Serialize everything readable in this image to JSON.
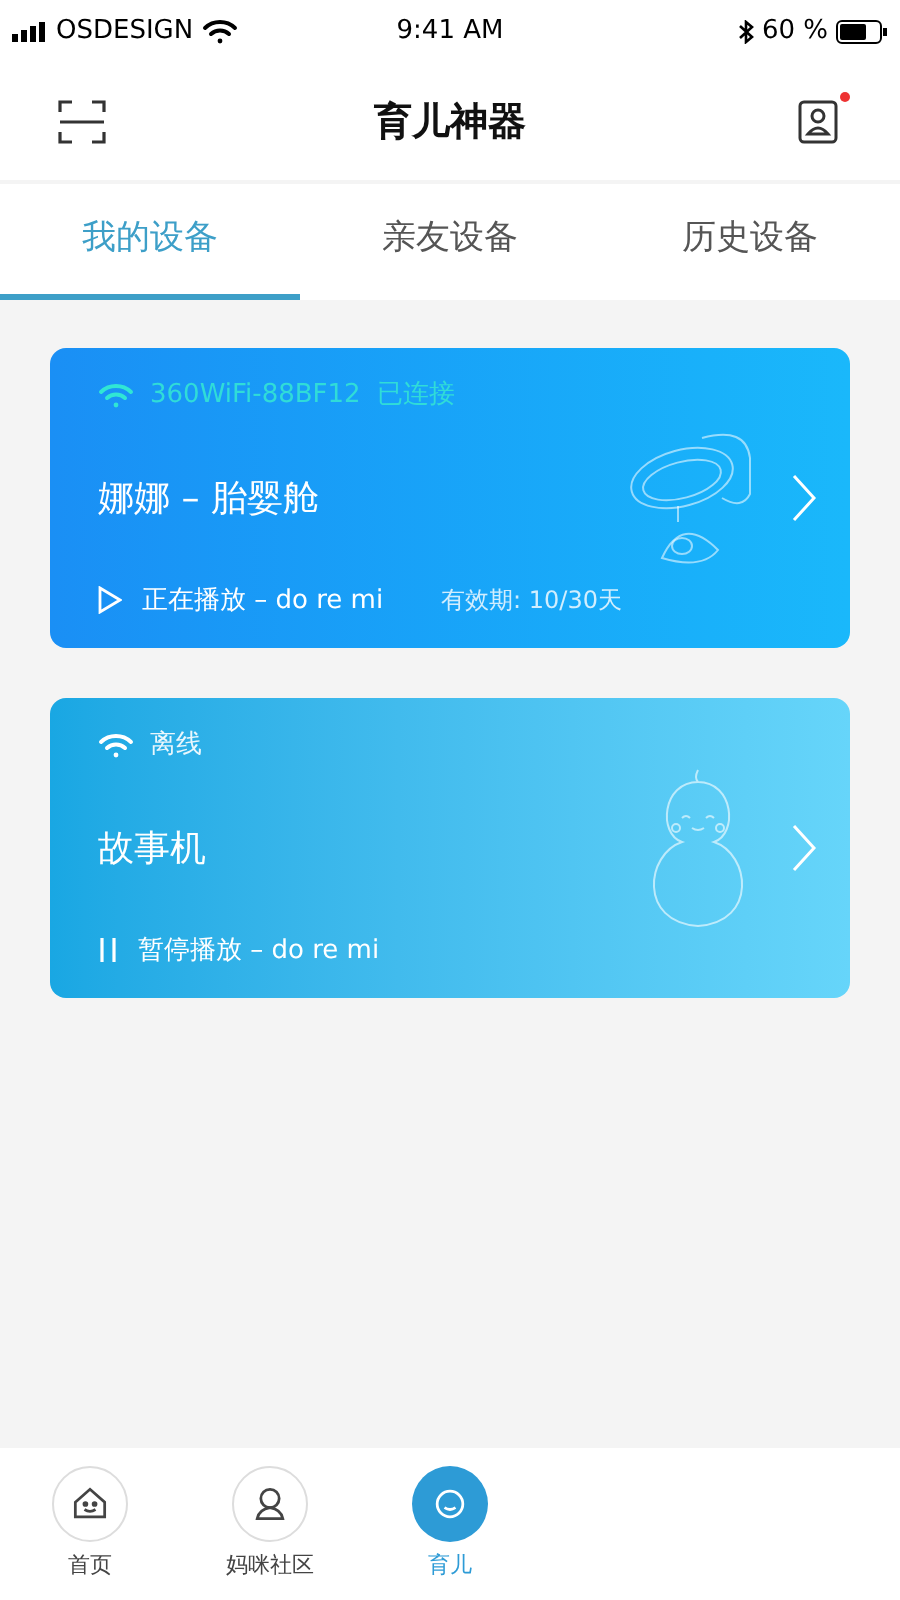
{
  "status_bar": {
    "carrier": "OSDESIGN",
    "time": "9:41 AM",
    "battery_text": "60 %"
  },
  "header": {
    "title": "育儿神器",
    "notification_dot": true
  },
  "tabs": [
    {
      "label": "我的设备",
      "selected": true
    },
    {
      "label": "亲友设备",
      "selected": false
    },
    {
      "label": "历史设备",
      "selected": false
    }
  ],
  "devices": [
    {
      "connected": true,
      "wifi_text": "360WiFi-88BF12",
      "status": "已连接",
      "name": "娜娜 – 胎婴舱",
      "kind": "cradle",
      "playing": true,
      "playback": "正在播放 – do re mi",
      "validity": "有效期: 10/30天"
    },
    {
      "connected": false,
      "status": "离线",
      "name": "故事机",
      "kind": "gourd",
      "playing": false,
      "playback": "暂停播放 – do re mi"
    }
  ],
  "bottom_nav": [
    {
      "label": "首页",
      "kind": "house",
      "selected": false
    },
    {
      "label": "妈咪社区",
      "kind": "person",
      "selected": false
    },
    {
      "label": "育儿",
      "kind": "face",
      "selected": true
    }
  ]
}
